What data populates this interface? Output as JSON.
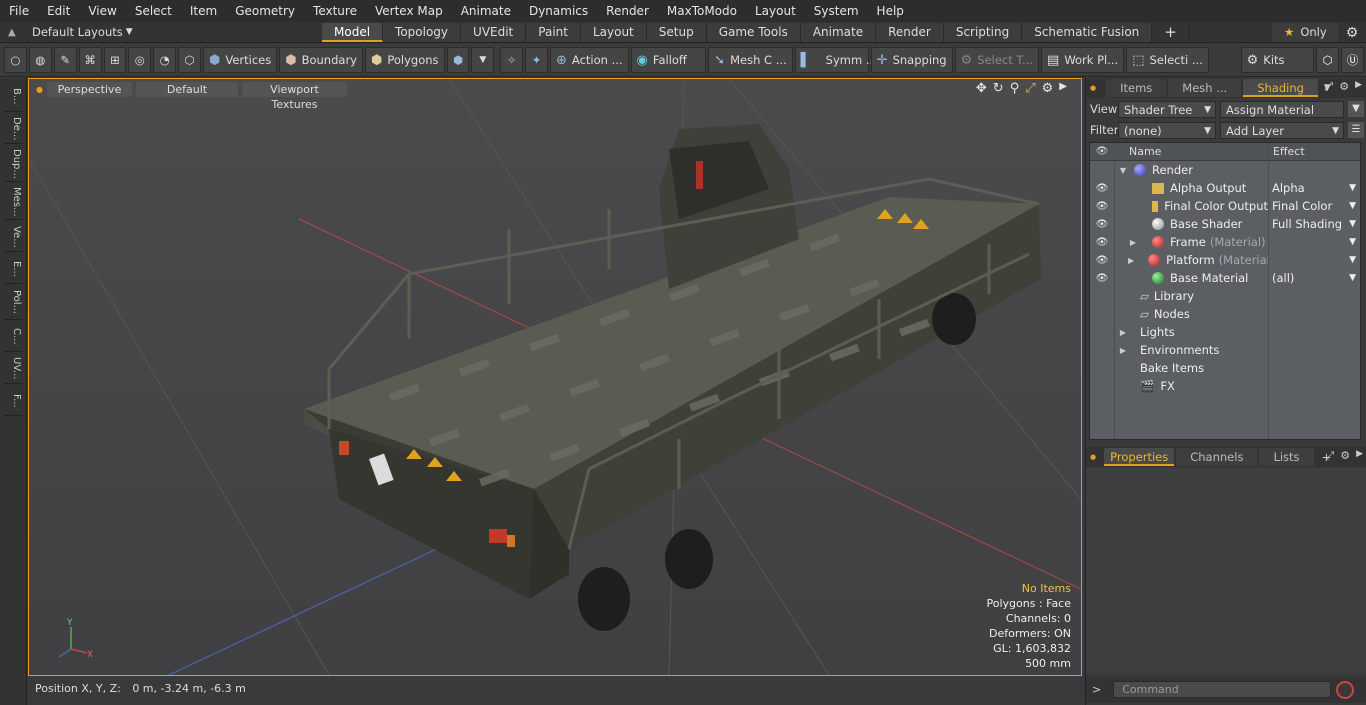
{
  "menu": [
    "File",
    "Edit",
    "View",
    "Select",
    "Item",
    "Geometry",
    "Texture",
    "Vertex Map",
    "Animate",
    "Dynamics",
    "Render",
    "MaxToModo",
    "Layout",
    "System",
    "Help"
  ],
  "layout_menu": "Default Layouts",
  "layout_tabs": [
    "Model",
    "Topology",
    "UVEdit",
    "Paint",
    "Layout",
    "Setup",
    "Game Tools",
    "Animate",
    "Render",
    "Scripting",
    "Schematic Fusion"
  ],
  "only_label": "Only",
  "toolbar": {
    "vertices": "Vertices",
    "boundary": "Boundary",
    "polygons": "Polygons",
    "action": "Action ...",
    "falloff": "Falloff",
    "meshc": "Mesh C ...",
    "symm": "Symm ...",
    "snapping": "Snapping",
    "selectt": "Select T...",
    "workpl": "Work Pl...",
    "selecti": "Selecti ...",
    "kits": "Kits"
  },
  "left_tabs": [
    "B...",
    "De...",
    "Dup...",
    "Mes...",
    "Ve...",
    "E...",
    "Pol...",
    "C...",
    "UV...",
    "F..."
  ],
  "viewport": {
    "buttons": [
      "Perspective",
      "Default",
      "Viewport Textures"
    ],
    "hud": {
      "items": "No Items",
      "polygons": "Polygons : Face",
      "channels": "Channels: 0",
      "deformers": "Deformers: ON",
      "gl": "GL: 1,603,832",
      "scale": "500 mm"
    },
    "axes": {
      "x": "X",
      "y": "Y"
    }
  },
  "status": {
    "position_label": "Position X, Y, Z:",
    "position_value": "0 m, -3.24 m, -6.3 m"
  },
  "right_panel": {
    "tabs": [
      "Items",
      "Mesh ...",
      "Shading"
    ],
    "view_label": "View",
    "view_value": "Shader Tree",
    "assign_material": "Assign Material",
    "filter_label": "Filter",
    "filter_value": "(none)",
    "add_layer": "Add Layer",
    "tree_header": {
      "name": "Name",
      "effect": "Effect"
    },
    "tree_rows": [
      {
        "name": "Render",
        "effect": "",
        "sub": "",
        "eye": false
      },
      {
        "name": "Alpha Output",
        "effect": "Alpha",
        "sub": "",
        "eye": true
      },
      {
        "name": "Final Color Output",
        "effect": "Final Color",
        "sub": "",
        "eye": true
      },
      {
        "name": "Base Shader",
        "effect": "Full Shading",
        "sub": "",
        "eye": true
      },
      {
        "name": "Frame",
        "effect": "",
        "sub": "(Material)",
        "eye": true
      },
      {
        "name": "Platform",
        "effect": "",
        "sub": "(Material)",
        "eye": true
      },
      {
        "name": "Base Material",
        "effect": "(all)",
        "sub": "",
        "eye": true
      },
      {
        "name": "Library",
        "effect": "",
        "sub": "",
        "eye": false
      },
      {
        "name": "Nodes",
        "effect": "",
        "sub": "",
        "eye": false
      },
      {
        "name": "Lights",
        "effect": "",
        "sub": "",
        "eye": false
      },
      {
        "name": "Environments",
        "effect": "",
        "sub": "",
        "eye": false
      },
      {
        "name": "Bake Items",
        "effect": "",
        "sub": "",
        "eye": false
      },
      {
        "name": "FX",
        "effect": "",
        "sub": "",
        "eye": false
      }
    ],
    "prop_tabs": [
      "Properties",
      "Channels",
      "Lists"
    ],
    "command_placeholder": "Command"
  },
  "colors": {
    "accent": "#e59d1f",
    "selected_tab": "#f0b23a"
  }
}
